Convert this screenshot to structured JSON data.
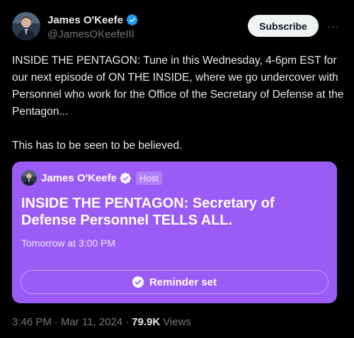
{
  "author": {
    "display_name": "James O'Keefe",
    "handle": "@JamesOKeefeIII",
    "verified_icon": "verified-badge-icon",
    "accent_color": "#1d9bf0"
  },
  "header": {
    "subscribe_label": "Subscribe",
    "more_label": "···"
  },
  "tweet": {
    "text": "INSIDE THE PENTAGON: Tune in this Wednesday, 4-6pm EST for our next episode of ON THE INSIDE, where we go undercover with Personnel who work for the Office of the Secretary of Defense at the Pentagon...\n\nThis has to be seen to be believed."
  },
  "space_card": {
    "background_color": "#9b5cf6",
    "host_name": "James O'Keefe",
    "host_badge": "Host",
    "title": "INSIDE THE PENTAGON: Secretary of Defense Personnel TELLS ALL.",
    "scheduled_time": "Tomorrow at 3:00 PM",
    "reminder_label": "Reminder set"
  },
  "meta": {
    "time": "3:46 PM",
    "separator": "·",
    "date": "Mar 11, 2024",
    "views_count": "79.9K",
    "views_label": "Views"
  }
}
